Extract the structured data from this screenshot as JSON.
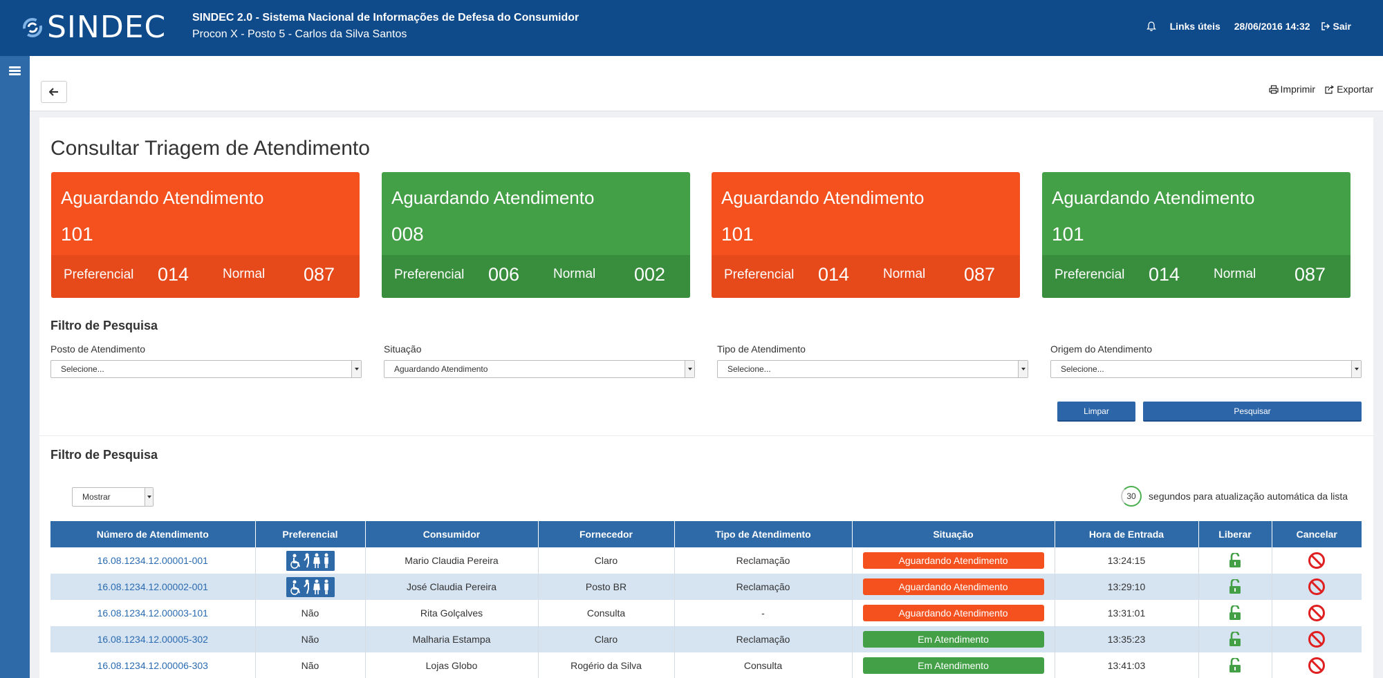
{
  "header": {
    "logo_text": "SINDEC",
    "system_title": "SINDEC 2.0 - Sistema Nacional de Informações de Defesa do Consumidor",
    "subtitle": "Procon X - Posto 5 - Carlos da Silva Santos",
    "links_label": "Links úteis",
    "datetime": "28/06/2016 14:32",
    "logout_label": "Sair"
  },
  "toolbar": {
    "print_label": "Imprimir",
    "export_label": "Exportar"
  },
  "page": {
    "title": "Consultar Triagem de Atendimento"
  },
  "cards": [
    {
      "title": "Aguardando Atendimento",
      "total": "101",
      "pref_label": "Preferencial",
      "pref": "014",
      "normal_label": "Normal",
      "normal": "087",
      "color": "#f4511e"
    },
    {
      "title": "Aguardando Atendimento",
      "total": "008",
      "pref_label": "Preferencial",
      "pref": "006",
      "normal_label": "Normal",
      "normal": "002",
      "color": "#43a047"
    },
    {
      "title": "Aguardando Atendimento",
      "total": "101",
      "pref_label": "Preferencial",
      "pref": "014",
      "normal_label": "Normal",
      "normal": "087",
      "color": "#f4511e"
    },
    {
      "title": "Aguardando Atendimento",
      "total": "101",
      "pref_label": "Preferencial",
      "pref": "014",
      "normal_label": "Normal",
      "normal": "087",
      "color": "#43a047"
    }
  ],
  "filters": {
    "title": "Filtro de Pesquisa",
    "fields": [
      {
        "label": "Posto de Atendimento",
        "value": "Selecione..."
      },
      {
        "label": "Situação",
        "value": "Aguardando Atendimento"
      },
      {
        "label": "Tipo de Atendimento",
        "value": "Selecione..."
      },
      {
        "label": "Origem do Atendimento",
        "value": "Selecione..."
      }
    ],
    "clear_label": "Limpar",
    "search_label": "Pesquisar"
  },
  "results": {
    "title": "Filtro de Pesquisa",
    "show_label": "Mostrar",
    "timer_value": "30",
    "timer_text": "segundos para atualização automática da lista",
    "columns": [
      "Número de Atendimento",
      "Preferencial",
      "Consumidor",
      "Fornecedor",
      "Tipo de Atendimento",
      "Situação",
      "Hora de Entrada",
      "Liberar",
      "Cancelar"
    ],
    "rows": [
      {
        "numero": "16.08.1234.12.00001-001",
        "preferencial": "",
        "consumidor": "Mario Claudia Pereira",
        "fornecedor": "Claro",
        "tipo": "Reclamação",
        "situacao": "Aguardando Atendimento",
        "hora": "13:24:15"
      },
      {
        "numero": "16.08.1234.12.00002-001",
        "preferencial": "",
        "consumidor": "José Claudia Pereira",
        "fornecedor": "Posto BR",
        "tipo": "Reclamação",
        "situacao": "Aguardando Atendimento",
        "hora": "13:29:10"
      },
      {
        "numero": "16.08.1234.12.00003-101",
        "preferencial": "Não",
        "consumidor": "Rita Golçalves",
        "fornecedor": "Consulta",
        "tipo": "-",
        "situacao": "Aguardando Atendimento",
        "hora": "13:31:01"
      },
      {
        "numero": "16.08.1234.12.00005-302",
        "preferencial": "Não",
        "consumidor": "Malharia Estampa",
        "fornecedor": "Claro",
        "tipo": "Reclamação",
        "situacao": "Em Atendimento",
        "hora": "13:35:23"
      },
      {
        "numero": "16.08.1234.12.00006-303",
        "preferencial": "Não",
        "consumidor": "Lojas Globo",
        "fornecedor": "Rogério da Silva",
        "tipo": "Consulta",
        "situacao": "Em Atendimento",
        "hora": "13:41:03"
      }
    ]
  },
  "colors": {
    "brand_blue": "#0f4a8a",
    "orange": "#f4511e",
    "green": "#43a047"
  },
  "icons": [
    "menu-icon",
    "bell-icon",
    "logout-icon",
    "back-arrow-icon",
    "print-icon",
    "export-icon",
    "accessibility-icon",
    "unlock-icon",
    "cancel-icon"
  ]
}
